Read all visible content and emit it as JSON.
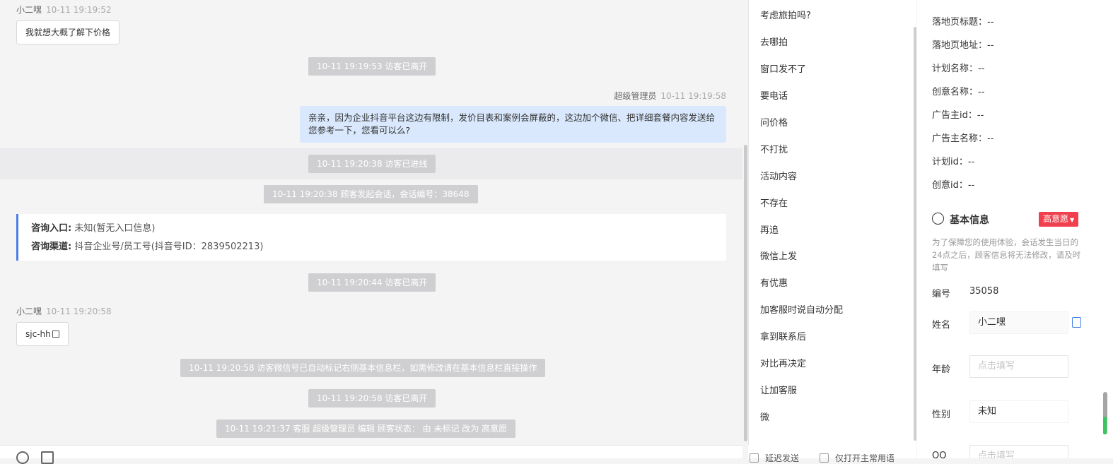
{
  "chat": {
    "msg1": {
      "sender": "小二嘿",
      "time": "10-11 19:19:52",
      "text": "我就想大概了解下价格"
    },
    "sys1": "10-11 19:19:53 访客已离开",
    "agent": {
      "name": "超级管理员",
      "time": "10-11 19:19:58",
      "text": "亲亲，因为企业抖音平台这边有限制，发价目表和案例会屏蔽的，这边加个微信、把详细套餐内容发送给您参考一下，您看可以么?"
    },
    "sys2": "10-11 19:20:38 访客已进线",
    "sys3": "10-11 19:20:38 顾客发起会话，会话编号：38648",
    "info": {
      "entry_key": "咨询入口:",
      "entry_val": "未知(暂无入口信息)",
      "channel_key": "咨询渠道:",
      "channel_val": "抖音企业号/员工号(抖音号ID：2839502213)"
    },
    "sys4": "10-11 19:20:44 访客已离开",
    "msg2": {
      "sender": "小二嘿",
      "time": "10-11 19:20:58",
      "text": "sjc-hh"
    },
    "sys5": "10-11 19:20:58 访客微信号已自动标记右侧基本信息栏，如需修改请在基本信息栏直接操作",
    "sys6": "10-11 19:20:58 访客已离开",
    "sys7": "10-11 19:21:37 客服 超级管理员 编辑 顾客状态： 由 未标记 改为 高意愿"
  },
  "quick_replies": [
    "考虑旅拍吗?",
    "去哪拍",
    "窗口发不了",
    "要电话",
    "问价格",
    "不打扰",
    "活动内容",
    "不存在",
    "再追",
    "微信上发",
    "有优惠",
    "加客服时说自动分配",
    "拿到联系后",
    "对比再决定",
    "让加客服",
    "微"
  ],
  "quick_bottom": {
    "opt1": "延迟发送",
    "opt2": "仅打开主常用语"
  },
  "ad_info": [
    {
      "label": "落地页标题：",
      "value": "--"
    },
    {
      "label": "落地页地址：",
      "value": "--"
    },
    {
      "label": "计划名称：",
      "value": "--"
    },
    {
      "label": "创意名称：",
      "value": "--"
    },
    {
      "label": "广告主id：",
      "value": "--"
    },
    {
      "label": "广告主名称：",
      "value": "--"
    },
    {
      "label": "计划id：",
      "value": "--"
    },
    {
      "label": "创意id：",
      "value": "--"
    }
  ],
  "basic": {
    "title": "基本信息",
    "tag": "高意愿",
    "note": "为了保障您的使用体验，会话发生当日的24点之后，顾客信息将无法修改，请及时填写",
    "id_label": "编号",
    "id_value": "35058",
    "name_label": "姓名",
    "name_value": "小二嘿",
    "age_label": "年龄",
    "age_placeholder": "点击填写",
    "gender_label": "性别",
    "gender_value": "未知",
    "qq_label": "QQ",
    "qq_placeholder": "点击填写"
  },
  "colors": {
    "accent": "#4a7de8",
    "tag": "#f0404e",
    "agent_bubble": "#d9e8fd"
  }
}
